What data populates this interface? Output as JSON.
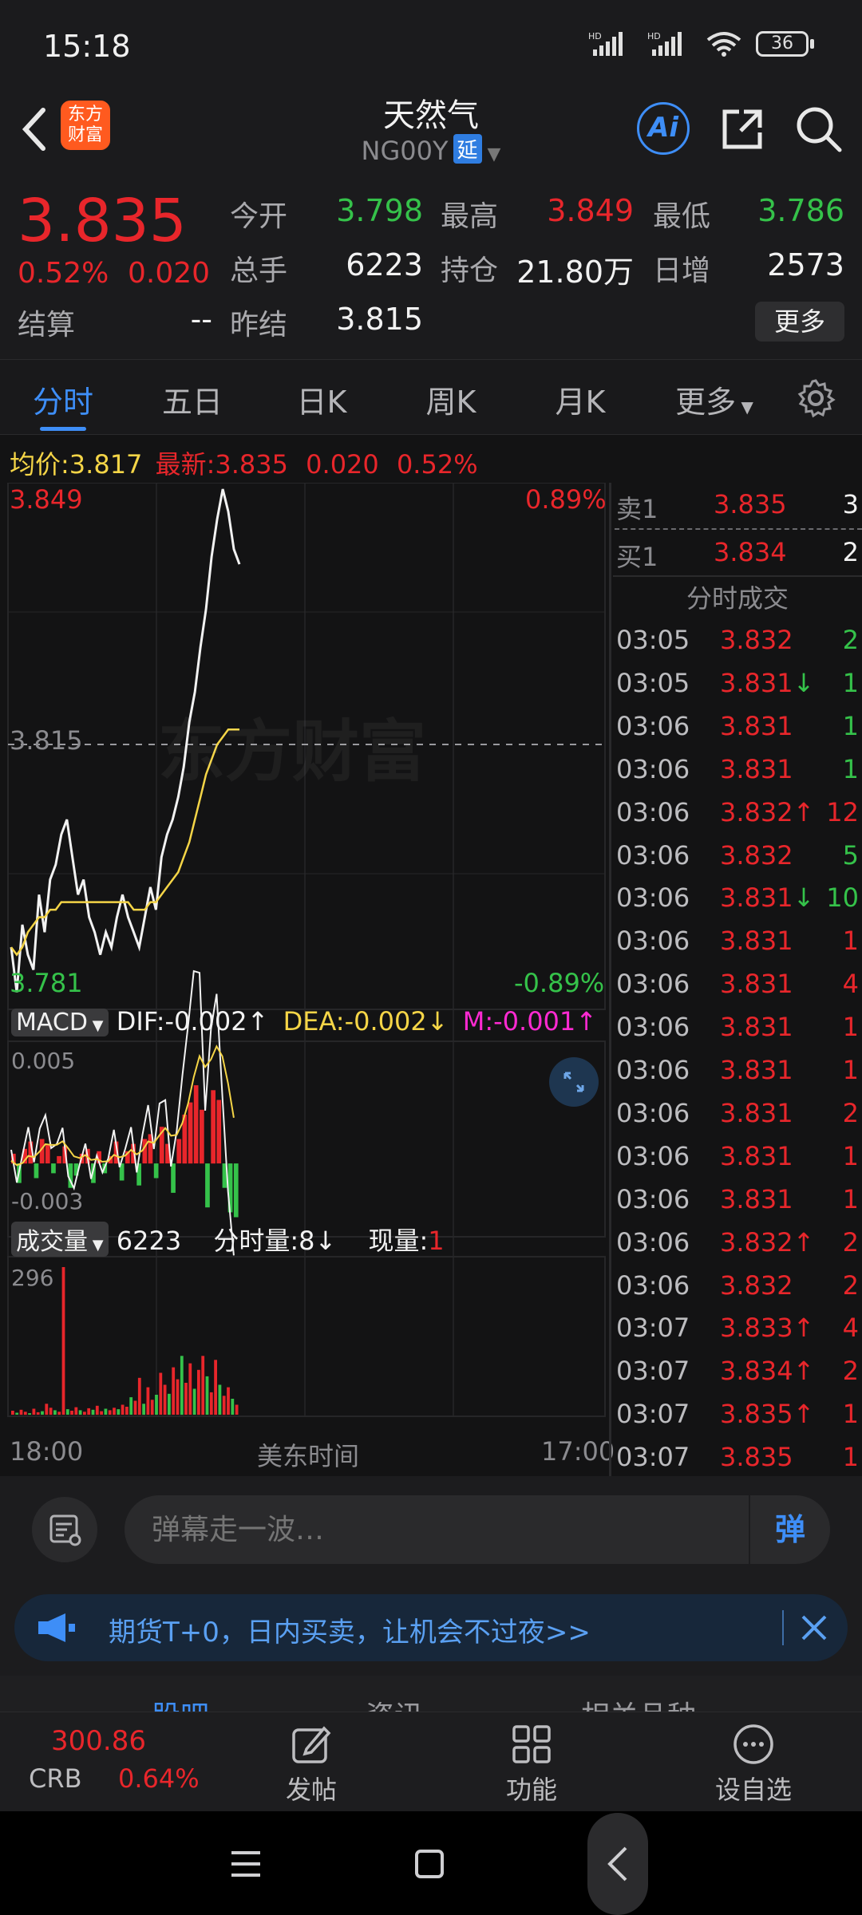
{
  "status_bar": {
    "time": "15:18",
    "battery": "36"
  },
  "header": {
    "title": "天然气",
    "code": "NG00Y",
    "delay_badge": "延",
    "logo_text": "东方财富"
  },
  "quote": {
    "price": "3.835",
    "change_pct": "0.52%",
    "change": "0.020",
    "settle_label": "结算",
    "settle_value": "--",
    "rows": [
      {
        "l1": "今开",
        "v1": "3.798",
        "l2": "最高",
        "v2": "3.849",
        "l3": "最低",
        "v3": "3.786"
      },
      {
        "l1": "总手",
        "v1": "6223",
        "l2": "持仓",
        "v2": "21.80万",
        "l3": "日增",
        "v3": "2573"
      }
    ],
    "prev_settle_label": "昨结",
    "prev_settle_value": "3.815",
    "more_button": "更多"
  },
  "tabs": [
    "分时",
    "五日",
    "日K",
    "周K",
    "月K",
    "更多"
  ],
  "colors": {
    "up": "#e8262b",
    "down": "#35c24a",
    "accent": "#3e8ef7",
    "avg": "#f5d547",
    "bg": "#131314"
  },
  "chart_legend": {
    "avg_label": "均价:",
    "avg_value": "3.817",
    "latest_label": "最新:",
    "latest_value": "3.835",
    "latest_change": "0.020",
    "latest_pct": "0.52%"
  },
  "price_axis": {
    "high": "3.849",
    "low": "3.781",
    "mid": "3.815",
    "high_pct": "0.89%",
    "low_pct": "-0.89%"
  },
  "macd_legend": {
    "name": "MACD",
    "dif": "DIF:-0.002",
    "dea": "DEA:-0.002",
    "m": "M:-0.001",
    "top": "0.005",
    "bottom": "-0.003"
  },
  "volume_legend": {
    "name": "成交量",
    "total": "6223",
    "minute_label": "分时量:8",
    "current_label": "现量:",
    "current_value": "1",
    "top": "296"
  },
  "time_axis": {
    "start": "18:00",
    "middle": "美东时间",
    "end": "17:00"
  },
  "watermark": "东方财富",
  "order_book": {
    "sell1": {
      "label": "卖1",
      "price": "3.835",
      "qty": "3"
    },
    "buy1": {
      "label": "买1",
      "price": "3.834",
      "qty": "2"
    },
    "ticks_title": "分时成交"
  },
  "ticks": [
    {
      "time": "03:05",
      "price": "3.832",
      "dir": "",
      "qty": "2",
      "qty_color": "green"
    },
    {
      "time": "03:05",
      "price": "3.831",
      "dir": "↓",
      "qty": "1",
      "qty_color": "green"
    },
    {
      "time": "03:06",
      "price": "3.831",
      "dir": "",
      "qty": "1",
      "qty_color": "green"
    },
    {
      "time": "03:06",
      "price": "3.831",
      "dir": "",
      "qty": "1",
      "qty_color": "green"
    },
    {
      "time": "03:06",
      "price": "3.832",
      "dir": "↑",
      "qty": "12",
      "qty_color": "red"
    },
    {
      "time": "03:06",
      "price": "3.832",
      "dir": "",
      "qty": "5",
      "qty_color": "green"
    },
    {
      "time": "03:06",
      "price": "3.831",
      "dir": "↓",
      "qty": "10",
      "qty_color": "green"
    },
    {
      "time": "03:06",
      "price": "3.831",
      "dir": "",
      "qty": "1",
      "qty_color": "red"
    },
    {
      "time": "03:06",
      "price": "3.831",
      "dir": "",
      "qty": "4",
      "qty_color": "red"
    },
    {
      "time": "03:06",
      "price": "3.831",
      "dir": "",
      "qty": "1",
      "qty_color": "red"
    },
    {
      "time": "03:06",
      "price": "3.831",
      "dir": "",
      "qty": "1",
      "qty_color": "red"
    },
    {
      "time": "03:06",
      "price": "3.831",
      "dir": "",
      "qty": "2",
      "qty_color": "red"
    },
    {
      "time": "03:06",
      "price": "3.831",
      "dir": "",
      "qty": "1",
      "qty_color": "red"
    },
    {
      "time": "03:06",
      "price": "3.831",
      "dir": "",
      "qty": "1",
      "qty_color": "red"
    },
    {
      "time": "03:06",
      "price": "3.832",
      "dir": "↑",
      "qty": "2",
      "qty_color": "red"
    },
    {
      "time": "03:06",
      "price": "3.832",
      "dir": "",
      "qty": "2",
      "qty_color": "red"
    },
    {
      "time": "03:07",
      "price": "3.833",
      "dir": "↑",
      "qty": "4",
      "qty_color": "red"
    },
    {
      "time": "03:07",
      "price": "3.834",
      "dir": "↑",
      "qty": "2",
      "qty_color": "red"
    },
    {
      "time": "03:07",
      "price": "3.835",
      "dir": "↑",
      "qty": "1",
      "qty_color": "red"
    },
    {
      "time": "03:07",
      "price": "3.835",
      "dir": "",
      "qty": "1",
      "qty_color": "red"
    }
  ],
  "comment": {
    "placeholder": "弹幕走一波…",
    "danmu_button": "弹"
  },
  "ad": {
    "text": "期货T+0，日内买卖，让机会不过夜>>"
  },
  "bottom_tabs": [
    "股吧",
    "资讯",
    "相关品种"
  ],
  "toolbar": {
    "crb_value": "300.86",
    "crb_label": "CRB",
    "crb_pct": "0.64%",
    "post": "发帖",
    "func": "功能",
    "watch": "设自选"
  },
  "chart_data": {
    "type": "line",
    "title": "",
    "ylim": [
      3.781,
      3.849
    ],
    "reference": 3.815,
    "series": [
      {
        "values": [
          3.788,
          3.782,
          3.791,
          3.787,
          3.785,
          3.795,
          3.79,
          3.797,
          3.799,
          3.803,
          3.805,
          3.8,
          3.795,
          3.797,
          3.792,
          3.79,
          3.787,
          3.79,
          3.788,
          3.792,
          3.795,
          3.792,
          3.79,
          3.788,
          3.792,
          3.796,
          3.793,
          3.8,
          3.803,
          3.805,
          3.808,
          3.812,
          3.818,
          3.822,
          3.828,
          3.833,
          3.84,
          3.845,
          3.849,
          3.846,
          3.841,
          3.839
        ]
      },
      {
        "values": [
          3.788,
          3.787,
          3.788,
          3.79,
          3.791,
          3.792,
          3.792,
          3.793,
          3.793,
          3.794,
          3.794,
          3.794,
          3.794,
          3.794,
          3.794,
          3.794,
          3.794,
          3.794,
          3.794,
          3.794,
          3.794,
          3.794,
          3.793,
          3.793,
          3.793,
          3.794,
          3.794,
          3.795,
          3.796,
          3.797,
          3.798,
          3.8,
          3.802,
          3.805,
          3.808,
          3.811,
          3.813,
          3.815,
          3.816,
          3.817,
          3.817,
          3.817
        ]
      }
    ]
  },
  "macd_data": {
    "ylim": [
      -0.003,
      0.005
    ],
    "hist": [
      0.0004,
      -0.0008,
      0.0006,
      0.0009,
      -0.0006,
      0.001,
      0.0008,
      -0.0004,
      0.0003,
      0.0007,
      -0.001,
      -0.0005,
      0.0004,
      0.0006,
      -0.0008,
      0.0005,
      -0.0004,
      0.0003,
      0.0009,
      -0.0007,
      0.0005,
      0.0008,
      -0.0009,
      0.001,
      0.0012,
      -0.0006,
      0.0015,
      0.0008,
      -0.0012,
      0.001,
      0.002,
      0.0025,
      0.0032,
      0.0022,
      -0.0018,
      0.003,
      0.0026,
      -0.001,
      -0.002,
      -0.0022
    ]
  },
  "volume_data": {
    "ymax": 296,
    "bars": [
      8,
      4,
      10,
      6,
      3,
      12,
      5,
      7,
      22,
      14,
      9,
      6,
      296,
      11,
      8,
      15,
      9,
      6,
      13,
      10,
      18,
      7,
      12,
      9,
      14,
      11,
      20,
      16,
      35,
      28,
      74,
      22,
      55,
      30,
      40,
      84,
      60,
      42,
      95,
      71,
      118,
      64,
      103,
      52,
      90,
      118,
      77,
      45,
      110,
      60,
      38,
      55,
      32,
      20
    ]
  }
}
